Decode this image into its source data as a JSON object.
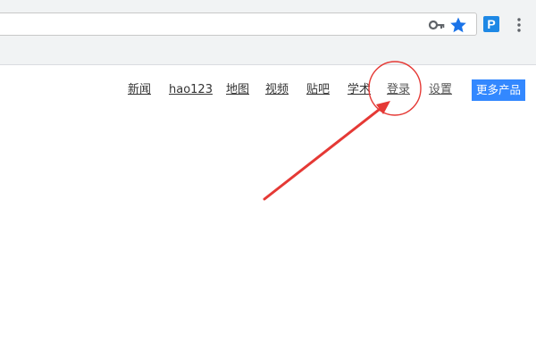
{
  "browser": {
    "extension_label": "P",
    "key_icon": "key-icon",
    "star_icon": "star-icon",
    "menu_icon": "more-vert-icon",
    "accent": "#1e88e5"
  },
  "nav": {
    "items": [
      {
        "label": "新闻"
      },
      {
        "label": "hao123"
      },
      {
        "label": "地图"
      },
      {
        "label": "视频"
      },
      {
        "label": "贴吧"
      },
      {
        "label": "学术"
      },
      {
        "label": "登录"
      },
      {
        "label": "设置"
      }
    ],
    "more_label": "更多产品",
    "more_color": "#3388ff"
  },
  "annotation": {
    "color": "#e53935",
    "target": "登录"
  }
}
